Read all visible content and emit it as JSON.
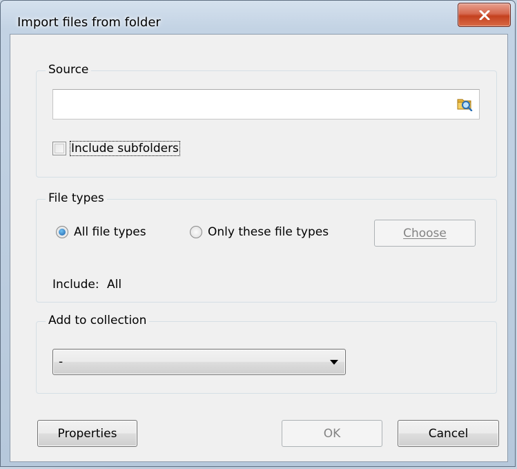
{
  "window": {
    "title": "Import files from folder",
    "close_label": "X"
  },
  "source": {
    "legend": "Source",
    "path_value": "",
    "include_subfolders_label": "Include subfolders",
    "include_subfolders_checked": false
  },
  "file_types": {
    "legend": "File types",
    "all_label": "All file types",
    "only_label": "Only these file types",
    "selected": "all",
    "choose_label": "Choose",
    "include_label": "Include:",
    "include_value": "All"
  },
  "collection": {
    "legend": "Add to collection",
    "selected": "-"
  },
  "buttons": {
    "properties": "Properties",
    "ok": "OK",
    "cancel": "Cancel"
  },
  "icons": {
    "browse": "folder-search-icon",
    "close": "close-icon"
  }
}
